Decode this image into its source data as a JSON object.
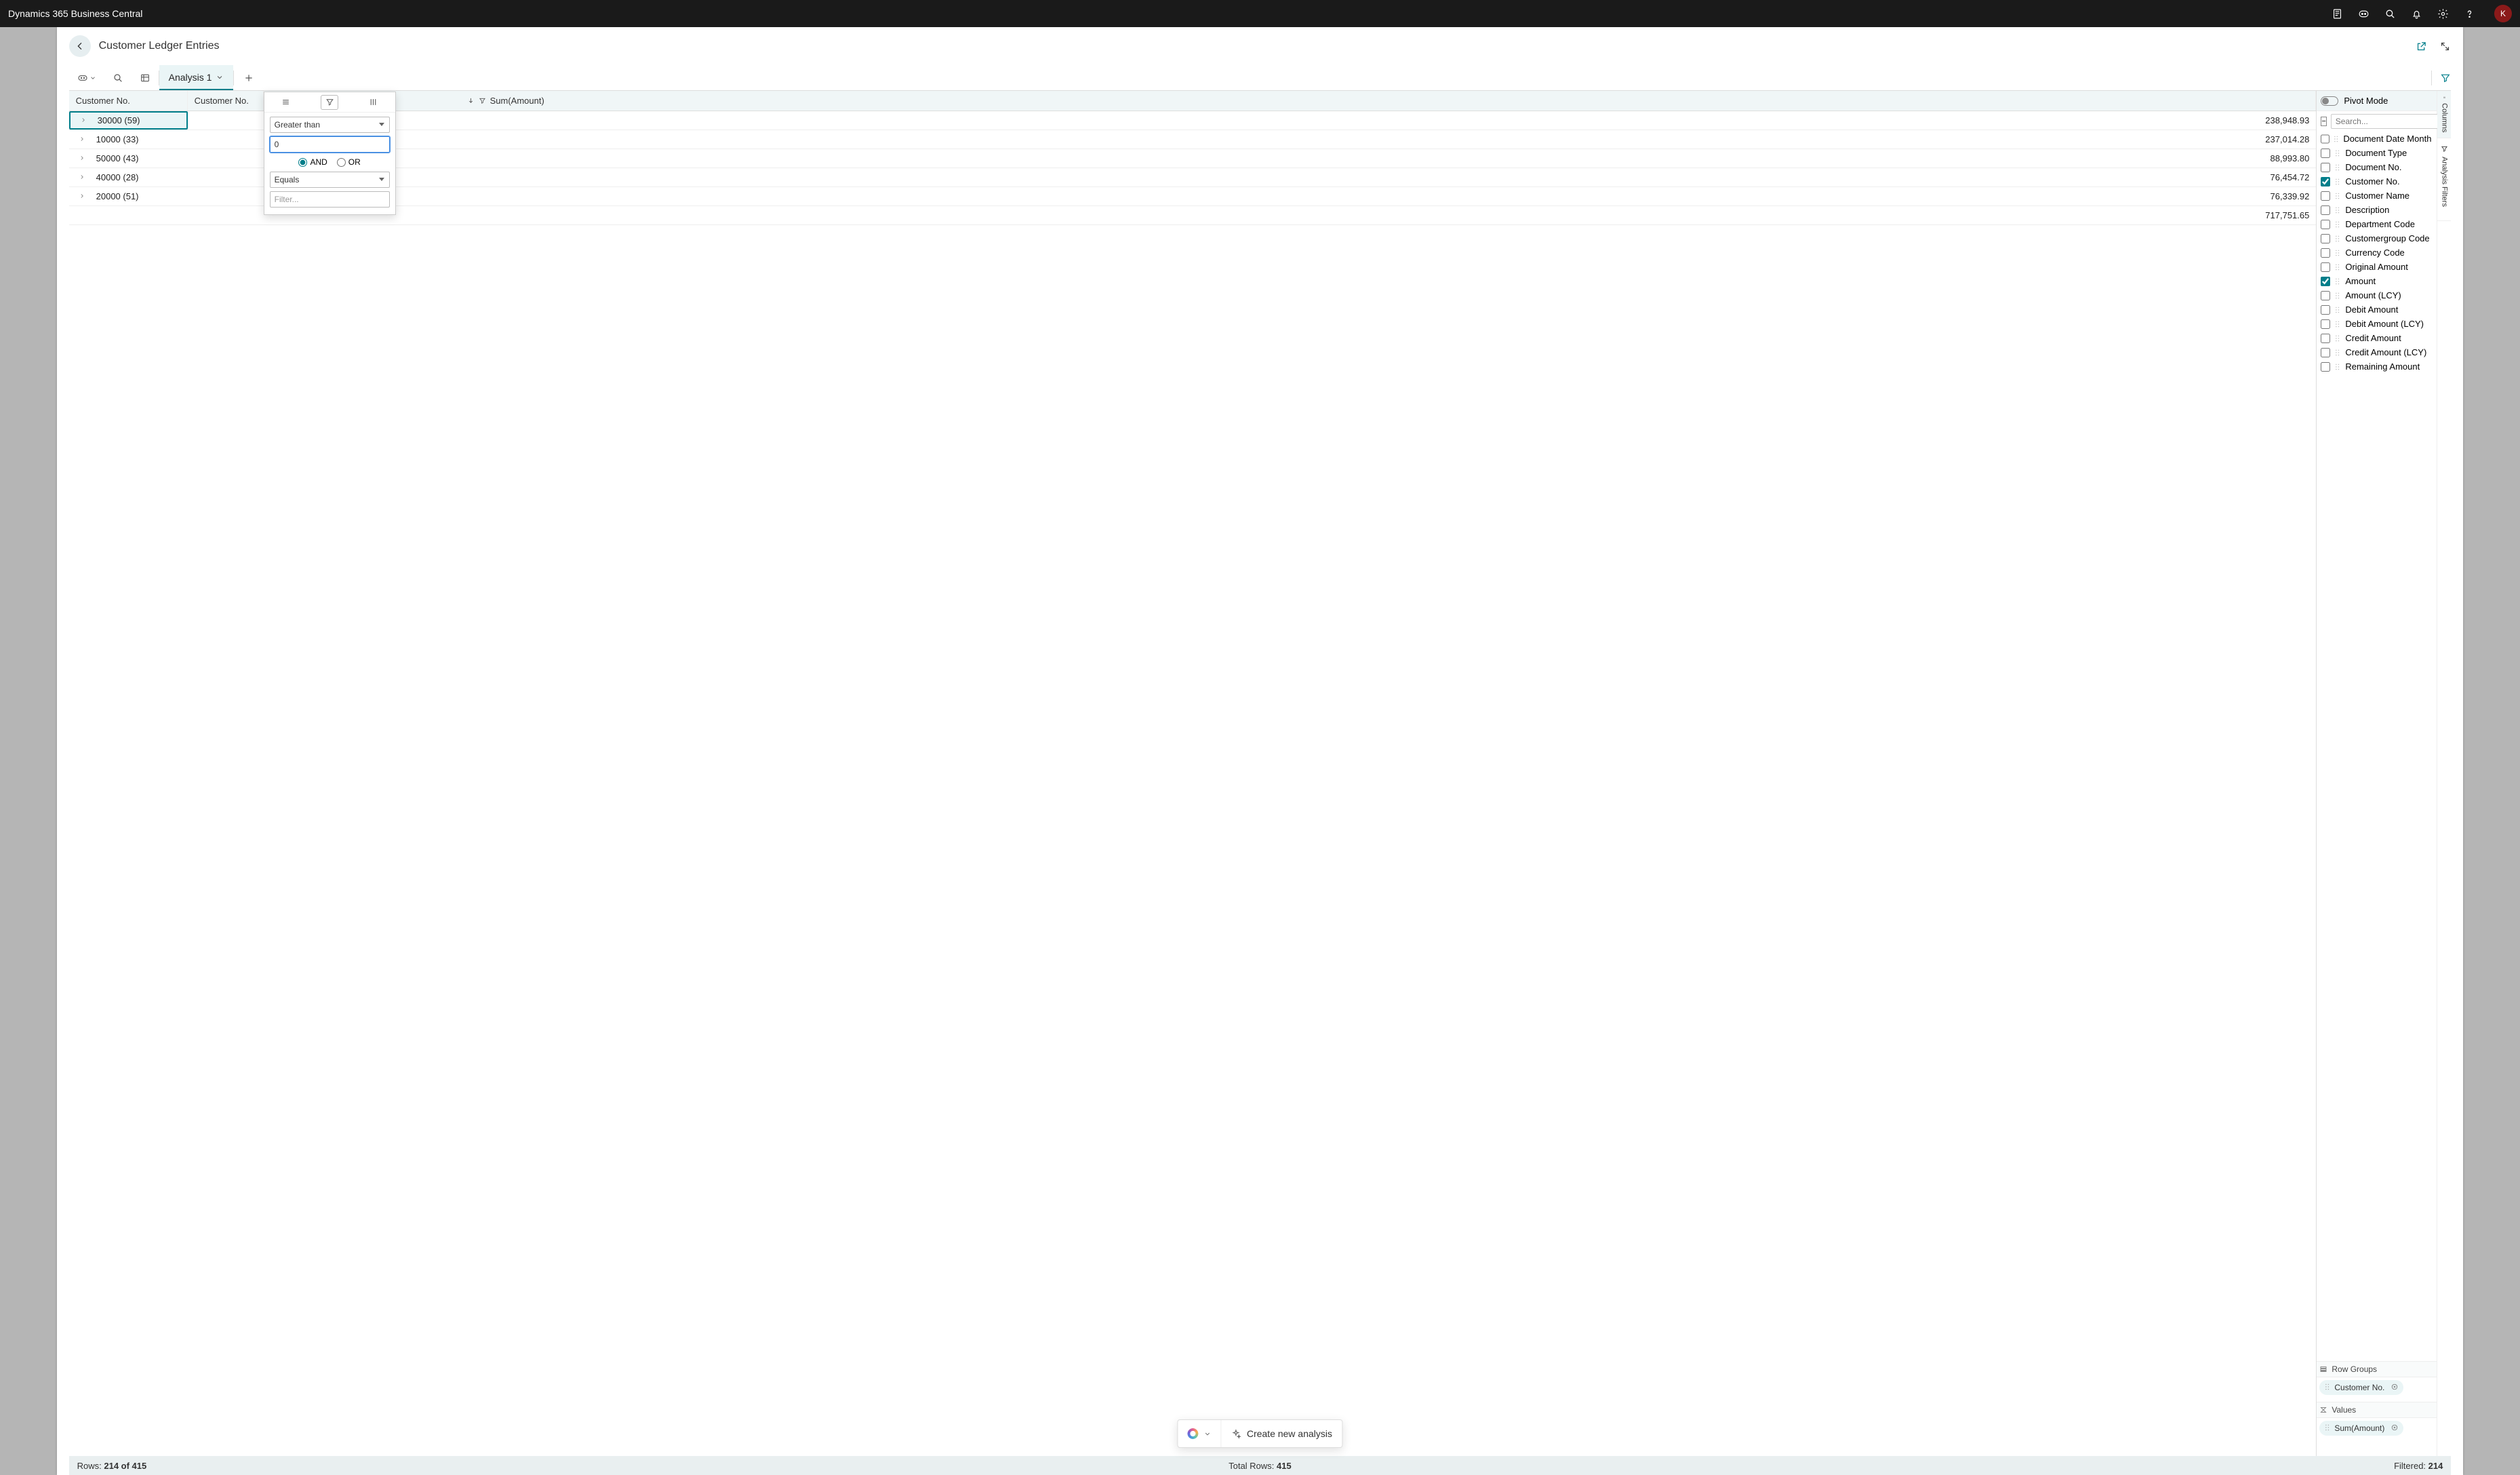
{
  "app_title": "Dynamics 365 Business Central",
  "avatar_letter": "K",
  "page_title": "Customer Ledger Entries",
  "toolbar": {
    "analysis_tab_label": "Analysis 1"
  },
  "grid": {
    "headers": {
      "group_col": "Customer No.",
      "col2": "Customer No.",
      "amount": "Sum(Amount)"
    },
    "rows": [
      {
        "label": "30000 (59)",
        "amount": "238,948.93",
        "selected": true
      },
      {
        "label": "10000 (33)",
        "amount": "237,014.28"
      },
      {
        "label": "50000 (43)",
        "amount": "88,993.80"
      },
      {
        "label": "40000 (28)",
        "amount": "76,454.72"
      },
      {
        "label": "20000 (51)",
        "amount": "76,339.92"
      }
    ],
    "total_amount": "717,751.65"
  },
  "filter_popup": {
    "op1": "Greater than",
    "val1": "0",
    "join_and": "AND",
    "join_or": "OR",
    "op2": "Equals",
    "val2_placeholder": "Filter..."
  },
  "columns_panel": {
    "pivot_label": "Pivot Mode",
    "search_placeholder": "Search...",
    "fields": [
      {
        "label": "Document Date Month",
        "checked": false,
        "sorted": true
      },
      {
        "label": "Document Type",
        "checked": false
      },
      {
        "label": "Document No.",
        "checked": false
      },
      {
        "label": "Customer No.",
        "checked": true
      },
      {
        "label": "Customer Name",
        "checked": false
      },
      {
        "label": "Description",
        "checked": false
      },
      {
        "label": "Department Code",
        "checked": false
      },
      {
        "label": "Customergroup Code",
        "checked": false
      },
      {
        "label": "Currency Code",
        "checked": false
      },
      {
        "label": "Original Amount",
        "checked": false
      },
      {
        "label": "Amount",
        "checked": true
      },
      {
        "label": "Amount (LCY)",
        "checked": false
      },
      {
        "label": "Debit Amount",
        "checked": false
      },
      {
        "label": "Debit Amount (LCY)",
        "checked": false
      },
      {
        "label": "Credit Amount",
        "checked": false
      },
      {
        "label": "Credit Amount (LCY)",
        "checked": false
      },
      {
        "label": "Remaining Amount",
        "checked": false
      }
    ],
    "row_groups_label": "Row Groups",
    "row_groups_chip": "Customer No.",
    "values_label": "Values",
    "values_chip": "Sum(Amount)"
  },
  "side_rails": {
    "columns_label": "Columns",
    "filters_label": "Analysis Filters"
  },
  "status": {
    "rows_prefix": "Rows: ",
    "rows_val": "214 of 415",
    "total_prefix": "Total Rows: ",
    "total_val": "415",
    "filtered_prefix": "Filtered: ",
    "filtered_val": "214"
  },
  "floating_bar": {
    "create_label": "Create new analysis"
  }
}
